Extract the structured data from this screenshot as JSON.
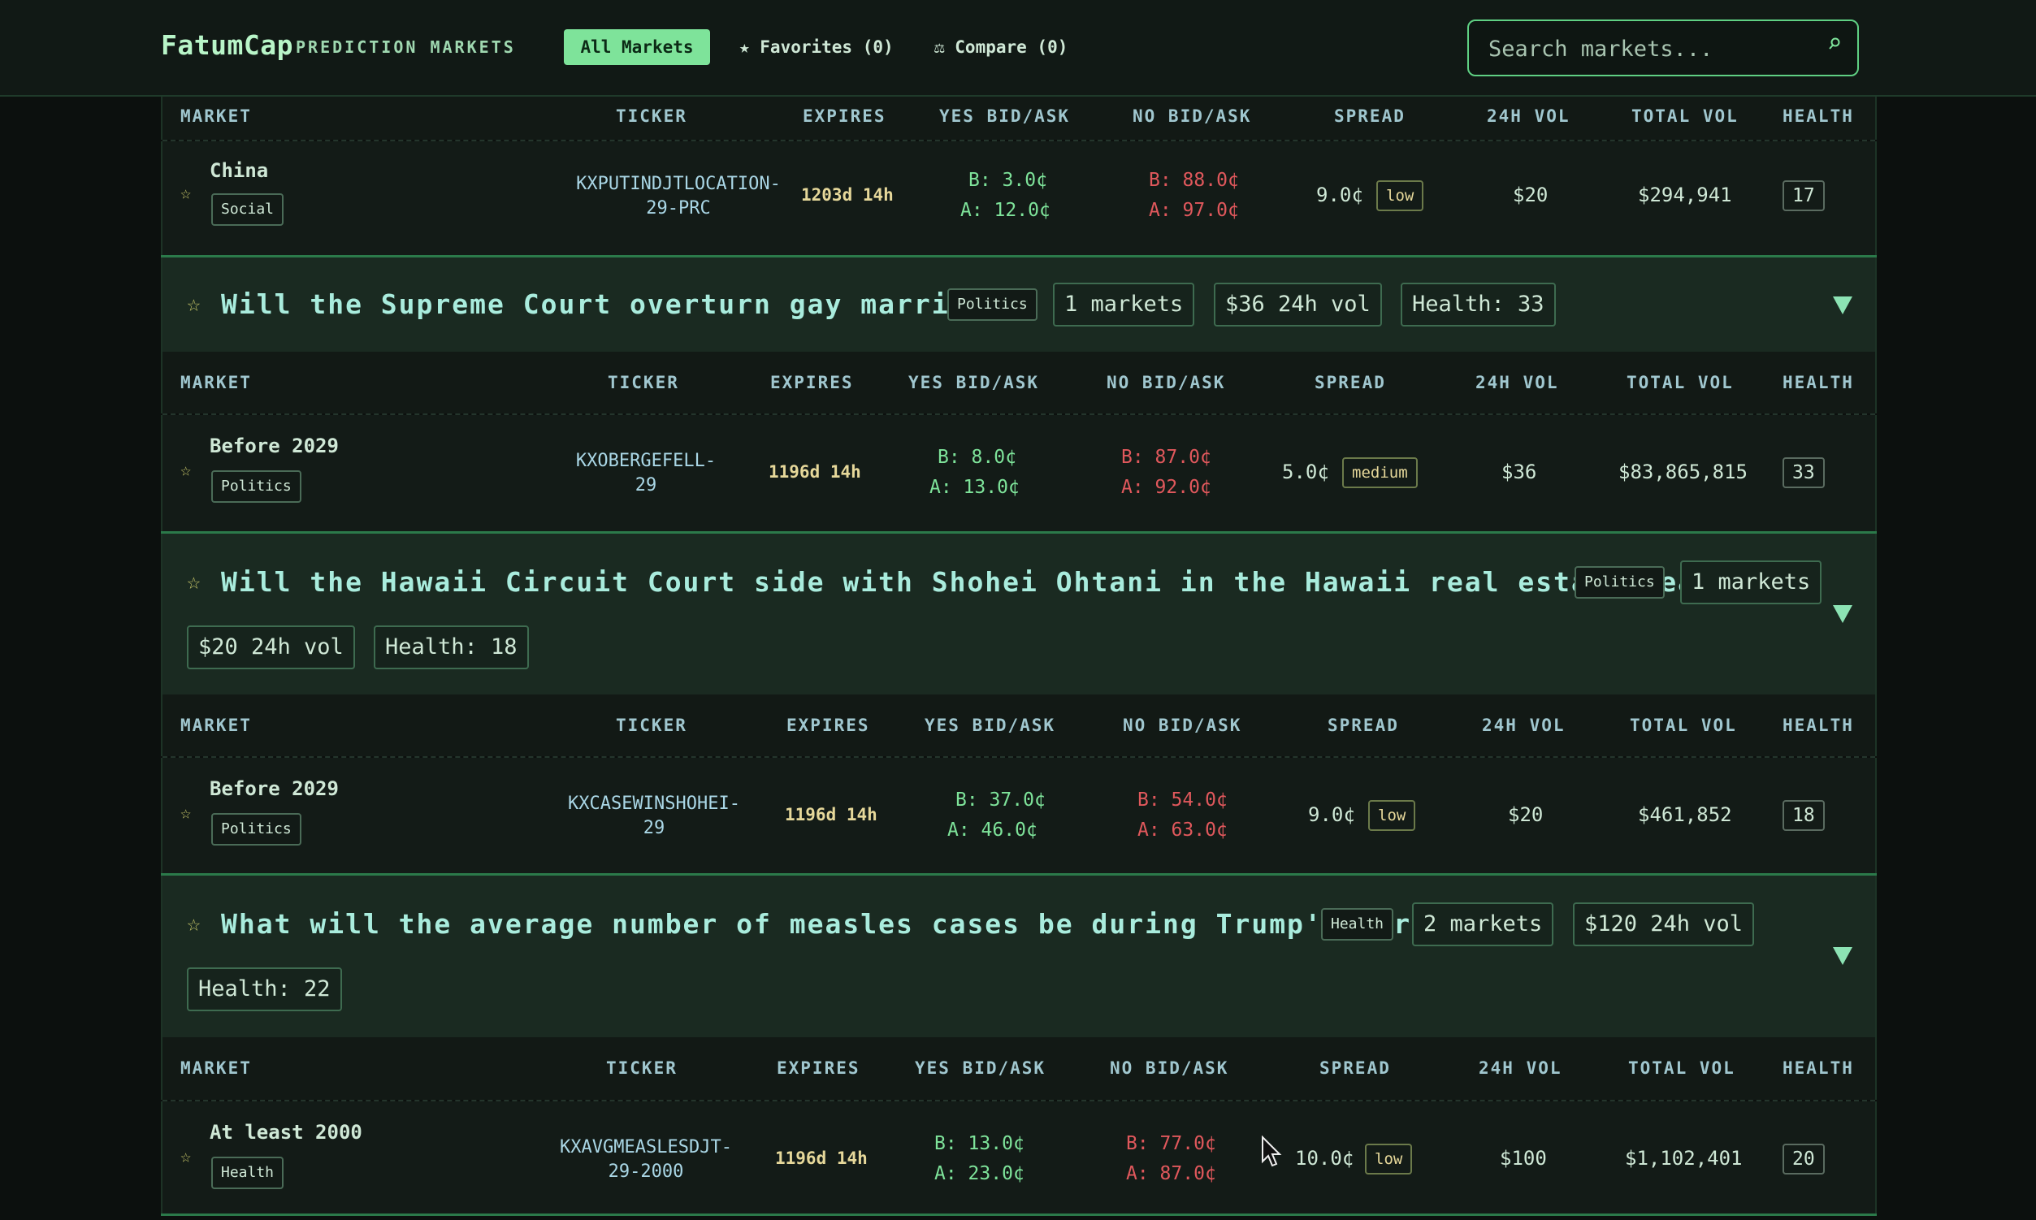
{
  "header": {
    "brand": "FatumCap",
    "subtitle": "PREDICTION MARKETS",
    "nav": {
      "all": "All Markets",
      "favorites": "★ Favorites (0)",
      "compare": "⚖ Compare (0)"
    },
    "search_placeholder": "Search markets..."
  },
  "columns": [
    "MARKET",
    "TICKER",
    "EXPIRES",
    "YES BID/ASK",
    "NO BID/ASK",
    "SPREAD",
    "24H VOL",
    "TOTAL VOL",
    "HEALTH"
  ],
  "top_market": {
    "name": "China",
    "tag": "Social",
    "ticker": [
      "KXPUTINDJTLOCATION-",
      "29-PRC"
    ],
    "expires": "1203d 14h",
    "yes_bid": "B: 3.0¢",
    "yes_ask": "A: 12.0¢",
    "no_bid": "B: 88.0¢",
    "no_ask": "A: 97.0¢",
    "spread": "9.0¢",
    "spread_level": "low",
    "vol_24h": "$20",
    "total_vol": "$294,941",
    "health": "17"
  },
  "groups": [
    {
      "title": "Will the Supreme Court overturn gay marriage?",
      "tag": "Politics",
      "markets_count": "1 markets",
      "vol_24h": "$36 24h vol",
      "health": "Health: 33",
      "markets": [
        {
          "name": "Before 2029",
          "tag": "Politics",
          "ticker": [
            "KXOBERGEFELL-",
            "29"
          ],
          "expires": "1196d 14h",
          "yes_bid": "B: 8.0¢",
          "yes_ask": "A: 13.0¢",
          "no_bid": "B: 87.0¢",
          "no_ask": "A: 92.0¢",
          "spread": "5.0¢",
          "spread_level": "medium",
          "vol_24h": "$36",
          "total_vol": "$83,865,815",
          "health": "33"
        }
      ]
    },
    {
      "title": "Will the Hawaii Circuit Court side with Shohei Ohtani in the Hawaii real estate deal?",
      "tag": "Politics",
      "markets_count": "1 markets",
      "vol_24h": "$20 24h vol",
      "health": "Health: 18",
      "markets": [
        {
          "name": "Before 2029",
          "tag": "Politics",
          "ticker": [
            "KXCASEWINSHOHEI-",
            "29"
          ],
          "expires": "1196d 14h",
          "yes_bid": "B: 37.0¢",
          "yes_ask": "A: 46.0¢",
          "no_bid": "B: 54.0¢",
          "no_ask": "A: 63.0¢",
          "spread": "9.0¢",
          "spread_level": "low",
          "vol_24h": "$20",
          "total_vol": "$461,852",
          "health": "18"
        }
      ]
    },
    {
      "title": "What will the average number of measles cases be during Trump's term?",
      "tag": "Health",
      "markets_count": "2 markets",
      "vol_24h": "$120 24h vol",
      "health": "Health: 22",
      "markets": [
        {
          "name": "At least 2000",
          "tag": "Health",
          "ticker": [
            "KXAVGMEASLESDJT-",
            "29-2000"
          ],
          "expires": "1196d 14h",
          "yes_bid": "B: 13.0¢",
          "yes_ask": "A: 23.0¢",
          "no_bid": "B: 77.0¢",
          "no_ask": "A: 87.0¢",
          "spread": "10.0¢",
          "spread_level": "low",
          "vol_24h": "$100",
          "total_vol": "$1,102,401",
          "health": "20"
        }
      ]
    }
  ],
  "icons": {
    "star": "star-icon",
    "expand": "chevron-down-icon",
    "search": "search-icon"
  },
  "colors": {
    "accent": "#7ee39a",
    "yes": "#7ee39a",
    "no": "#e0585c",
    "background": "#0c100e"
  }
}
